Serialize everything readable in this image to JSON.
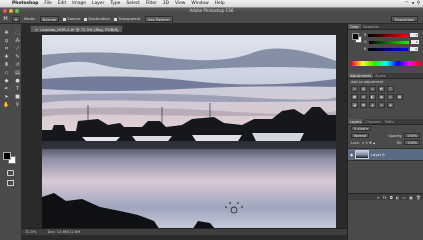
{
  "menubar": {
    "app": "Photoshop",
    "items": [
      "File",
      "Edit",
      "Image",
      "Layer",
      "Type",
      "Select",
      "Filter",
      "3D",
      "View",
      "Window",
      "Help"
    ]
  },
  "window": {
    "title": "Adobe Photoshop CS6"
  },
  "options": {
    "mode_label": "Mode:",
    "mode_value": "Normal",
    "chk1": "Source",
    "chk2": "Destination",
    "chk3": "Transparent",
    "button": "Use Pattern",
    "workspace": "Essentials"
  },
  "document": {
    "tab_title": "Lambda_HDR-2.tif @ 72.5% (Bkg, RGB/8)",
    "zoom": "72.5%",
    "doc_info": "Doc: 12.6M/12.6M"
  },
  "panels": {
    "color_tabs": [
      "Color",
      "Swatches"
    ],
    "sliders": [
      {
        "label": "R",
        "value": "0"
      },
      {
        "label": "G",
        "value": "0"
      },
      {
        "label": "B",
        "value": "0"
      }
    ],
    "adj_tabs": [
      "Adjustments",
      "Styles"
    ],
    "adj_title": "Add an adjustment",
    "layers_tabs": [
      "Layers",
      "Channels",
      "Paths"
    ],
    "blend_mode": "Normal",
    "opacity_label": "Opacity:",
    "opacity_value": "100%",
    "lock_label": "Lock:",
    "fill_label": "Fill:",
    "fill_value": "100%",
    "layer_name": "Layer 0"
  },
  "colors": {
    "fg": "#000000",
    "bg": "#ffffff",
    "selected_layer": "#5a6b82"
  }
}
